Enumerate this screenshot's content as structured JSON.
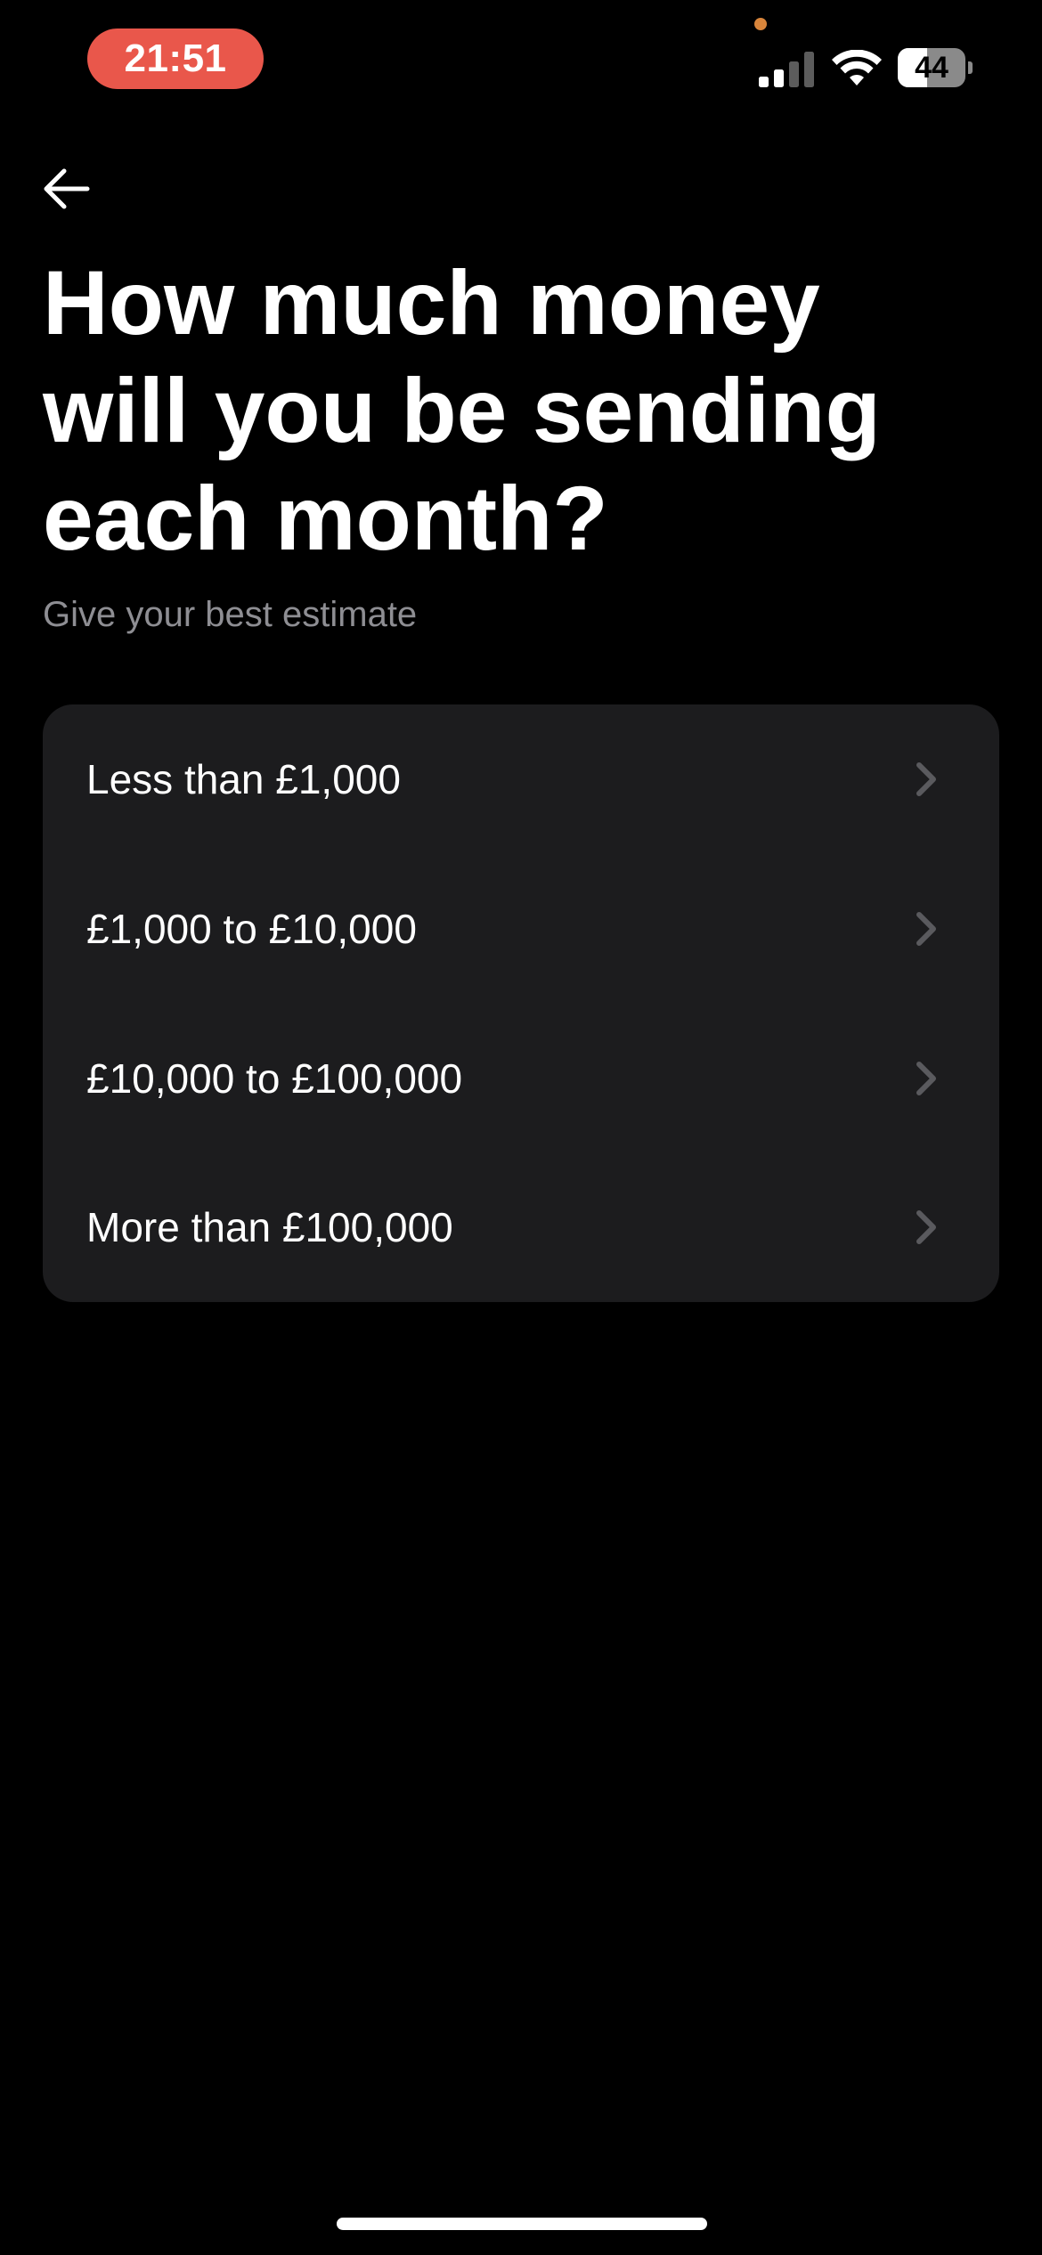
{
  "status_bar": {
    "time": "21:51",
    "battery_level": "44",
    "battery_percent": 44,
    "signal_bars_active": 2,
    "signal_bars_total": 4,
    "time_pill_color": "#e9574b",
    "privacy_dot_color": "#d9853b"
  },
  "header": {
    "back_icon": "arrow-left-icon"
  },
  "main": {
    "title": "How much money will you be sending each month?",
    "subtitle": "Give your best estimate",
    "options": [
      {
        "label": "Less than £1,000",
        "icon": "chevron-right-icon"
      },
      {
        "label": "£1,000 to £10,000",
        "icon": "chevron-right-icon"
      },
      {
        "label": "£10,000 to £100,000",
        "icon": "chevron-right-icon"
      },
      {
        "label": "More than £100,000",
        "icon": "chevron-right-icon"
      }
    ]
  },
  "colors": {
    "background": "#000000",
    "card": "#1c1c1e",
    "text_primary": "#ffffff",
    "text_secondary": "#8e8e93",
    "chevron": "#5a5a5e"
  }
}
